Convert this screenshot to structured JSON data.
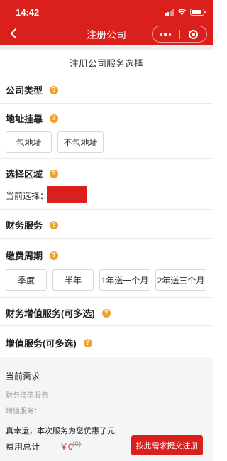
{
  "status_bar": {
    "time": "14:42"
  },
  "nav": {
    "title": "注册公司"
  },
  "page": {
    "subtitle": "注册公司服务选择"
  },
  "sections": {
    "company_type": {
      "title": "公司类型",
      "help": "?"
    },
    "address": {
      "title": "地址挂靠",
      "help": "?",
      "options": [
        "包地址",
        "不包地址"
      ]
    },
    "region": {
      "title": "选择区域",
      "help": "?",
      "current_label": "当前选择："
    },
    "finance": {
      "title": "财务服务",
      "help": "?"
    },
    "period": {
      "title": "缴费周期",
      "help": "?",
      "options": [
        "季度",
        "半年",
        "1年送一个月",
        "2年送三个月"
      ]
    },
    "finance_value_added": {
      "title": "财务增值服务(可多选)",
      "help": "?"
    },
    "value_added": {
      "title": "增值服务(可多选)",
      "help": "?"
    }
  },
  "footer": {
    "need_title": "当前需求",
    "finance_value_added_label": "财务增值服务：",
    "value_added_label": "增值服务：",
    "lucky_text": "真幸运，本次服务为您优惠了元",
    "total_label": "费用总计",
    "price": "￥0",
    "original_price": "(0)",
    "submit_label": "按此需求提交注册"
  },
  "colors": {
    "brand_red": "#d9201d",
    "help_orange": "#f0a02c"
  },
  "icons": [
    "back-chevron-icon",
    "more-dots-icon",
    "close-ring-icon",
    "signal-icon",
    "wifi-icon",
    "battery-icon",
    "help-icon"
  ]
}
